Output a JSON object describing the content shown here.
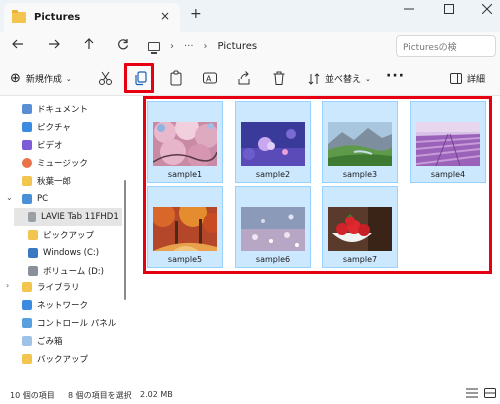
{
  "window": {
    "tab_title": "Pictures",
    "new_tab": "+",
    "tab_close": "×"
  },
  "address": {
    "location": "Pictures",
    "ellipsis": "···",
    "search_placeholder": "Picturesの検"
  },
  "toolbar": {
    "new_label": "新規作成",
    "sort_label": "並べ替え",
    "more": "···",
    "details_label": "詳細"
  },
  "sidebar": {
    "items": [
      {
        "label": "ドキュメント",
        "icon": "documents-icon"
      },
      {
        "label": "ピクチャ",
        "icon": "pictures-icon"
      },
      {
        "label": "ビデオ",
        "icon": "videos-icon"
      },
      {
        "label": "ミュージック",
        "icon": "music-icon"
      },
      {
        "label": "秋葉一郎",
        "icon": "user-folder-icon"
      },
      {
        "label": "PC",
        "icon": "pc-icon"
      },
      {
        "label": "LAVIE Tab 11FHD1",
        "icon": "device-icon"
      },
      {
        "label": "ピックアップ",
        "icon": "folder-icon"
      },
      {
        "label": "Windows (C:)",
        "icon": "drive-icon"
      },
      {
        "label": "ボリューム (D:)",
        "icon": "drive-icon"
      },
      {
        "label": "ライブラリ",
        "icon": "library-icon"
      },
      {
        "label": "ネットワーク",
        "icon": "network-icon"
      },
      {
        "label": "コントロール パネル",
        "icon": "control-panel-icon"
      },
      {
        "label": "ごみ箱",
        "icon": "recycle-bin-icon"
      },
      {
        "label": "バックアップ",
        "icon": "folder-icon"
      }
    ]
  },
  "files": [
    {
      "name": "sample1"
    },
    {
      "name": "sample2"
    },
    {
      "name": "sample3"
    },
    {
      "name": "sample4"
    },
    {
      "name": "sample5"
    },
    {
      "name": "sample6"
    },
    {
      "name": "sample7"
    }
  ],
  "status": {
    "count": "10 個の項目",
    "selected": "8 個の項目を選択",
    "size": "2.02 MB"
  },
  "colors": {
    "highlight": "#e60012",
    "selection": "#cce8ff",
    "folder": "#f4c54e"
  }
}
